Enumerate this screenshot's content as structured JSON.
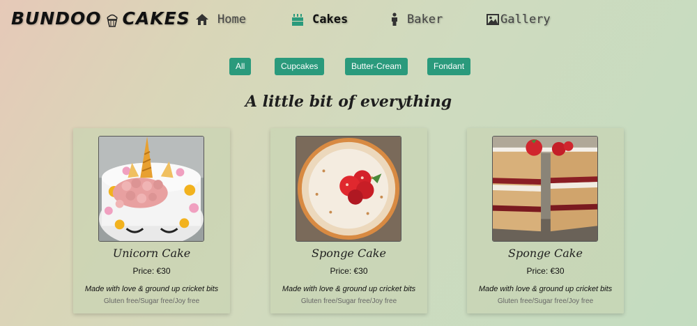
{
  "brand": {
    "left": "BUNDOO",
    "right": "CAKES",
    "icon": "cupcake-icon"
  },
  "nav": [
    {
      "label": "Home",
      "icon": "home-icon",
      "active": false
    },
    {
      "label": "Cakes",
      "icon": "cake-icon",
      "active": true
    },
    {
      "label": "Baker",
      "icon": "person-icon",
      "active": false
    },
    {
      "label": "Gallery",
      "icon": "image-icon",
      "active": false
    }
  ],
  "filters": [
    "All",
    "Cupcakes",
    "Butter-Cream",
    "Fondant"
  ],
  "section_title": "A little bit of everything",
  "cards": [
    {
      "name": "Unicorn Cake",
      "price": "Price: €30",
      "description": "Made with love & ground up cricket bits",
      "diet": "Gluten free/Sugar free/Joy free",
      "image": "unicorn-cake-photo"
    },
    {
      "name": "Sponge Cake",
      "price": "Price: €30",
      "description": "Made with love & ground up cricket bits",
      "diet": "Gluten free/Sugar free/Joy free",
      "image": "sponge-cake-strawberry-photo"
    },
    {
      "name": "Sponge Cake",
      "price": "Price: €30",
      "description": "Made with love & ground up cricket bits",
      "diet": "Gluten free/Sugar free/Joy free",
      "image": "sponge-cake-slice-photo"
    }
  ],
  "colors": {
    "accent": "#2a9a7c",
    "text": "#1e1e1e"
  }
}
